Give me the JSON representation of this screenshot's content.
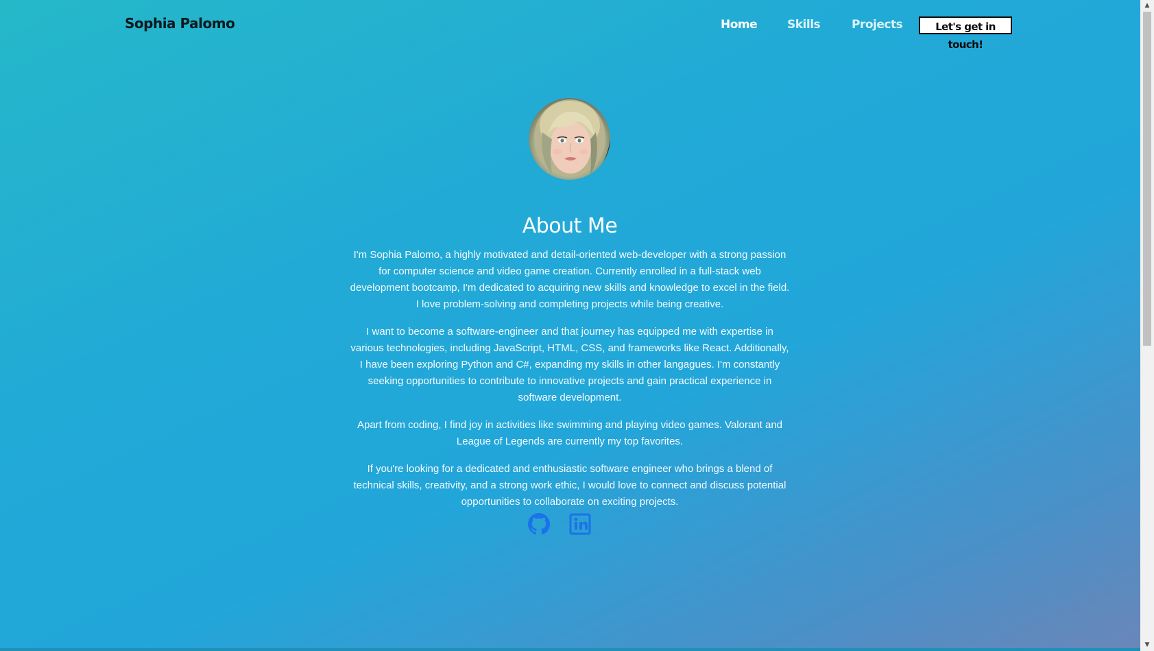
{
  "header": {
    "brand": "Sophia Palomo",
    "nav": {
      "home": "Home",
      "skills": "Skills",
      "projects": "Projects",
      "cta": "Let's get in touch!"
    }
  },
  "avatar": {
    "alt": "Profile photo of Sophia Palomo"
  },
  "about": {
    "title": "About Me",
    "paragraphs": [
      "I'm Sophia Palomo, a highly motivated and detail-oriented web-developer with a strong passion for computer science and video game creation. Currently enrolled in a full-stack web development bootcamp, I'm dedicated to acquiring new skills and knowledge to excel in the field. I love problem-solving and completing projects while being creative.",
      "I want to become a software-engineer and that journey has equipped me with expertise in various technologies, including JavaScript, HTML, CSS, and frameworks like React. Additionally, I have been exploring Python and C#, expanding my skills in other langagues. I'm constantly seeking opportunities to contribute to innovative projects and gain practical experience in software development.",
      "Apart from coding, I find joy in activities like swimming and playing video games. Valorant and League of Legends are currently my top favorites.",
      "If you're looking for a dedicated and enthusiastic software engineer who brings a blend of technical skills, creativity, and a strong work ethic, I would love to connect and discuss potential opportunities to collaborate on exciting projects."
    ]
  },
  "socials": {
    "github_icon": "github-icon",
    "linkedin_icon": "linkedin-icon",
    "icon_color": "#1a73e8"
  },
  "theme": {
    "gradient_start": "#25b8c9",
    "gradient_mid": "#22a6da",
    "gradient_end": "#6a86b8",
    "text": "#ffffff"
  }
}
